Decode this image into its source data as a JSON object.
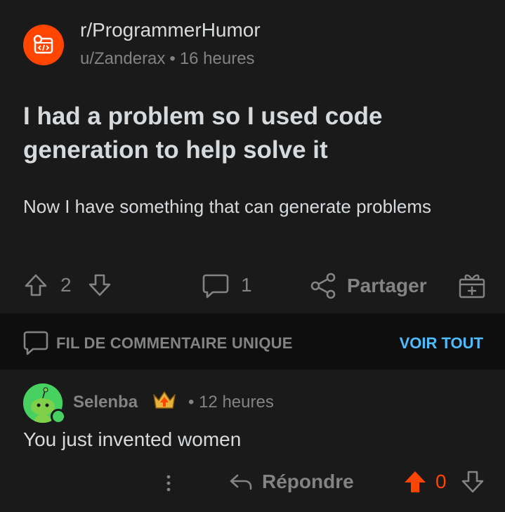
{
  "post": {
    "subreddit": "r/ProgrammerHumor",
    "author": "u/Zanderax",
    "separator": "•",
    "time": "16 heures",
    "title": "I had a problem so I used code generation to help solve it",
    "body": "Now I have something that can generate problems",
    "upvotes": "2",
    "comments": "1",
    "share_label": "Partager"
  },
  "thread_bar": {
    "label": "FIL DE COMMENTAIRE UNIQUE",
    "see_all": "VOIR TOUT"
  },
  "comment": {
    "author": "Selenba",
    "separator": "•",
    "time": "12 heures",
    "text": "You just invented women",
    "reply_label": "Répondre",
    "votes": "0"
  },
  "colors": {
    "accent": "#ff4500",
    "link": "#4fbcff",
    "online": "#46d160"
  }
}
